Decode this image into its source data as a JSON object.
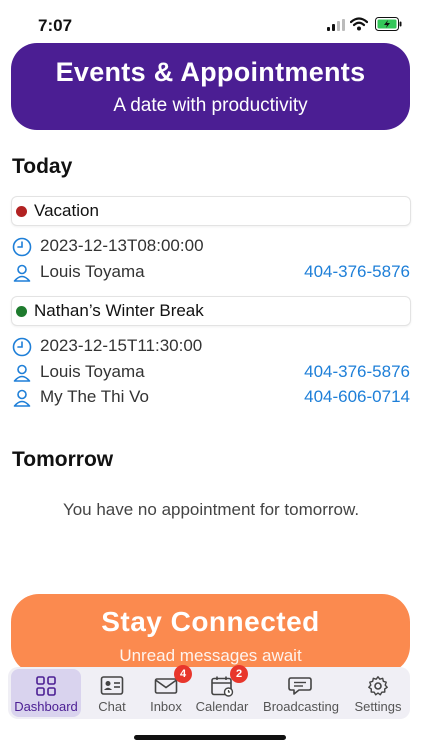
{
  "status": {
    "time": "7:07"
  },
  "header": {
    "title": "Events & Appointments",
    "subtitle": "A date with productivity"
  },
  "today": {
    "heading": "Today",
    "events": [
      {
        "name": "Vacation",
        "color": "#b22222",
        "datetime": "2023-12-13T08:00:00",
        "people": [
          {
            "name": "Louis Toyama",
            "phone": "404-376-5876"
          }
        ]
      },
      {
        "name": "Nathan’s Winter Break",
        "color": "#1e7b2e",
        "datetime": "2023-12-15T11:30:00",
        "people": [
          {
            "name": "Louis Toyama",
            "phone": "404-376-5876"
          },
          {
            "name": "My The Thi Vo",
            "phone": "404-606-0714"
          }
        ]
      }
    ]
  },
  "tomorrow": {
    "heading": "Tomorrow",
    "empty_text": "You have no appointment for tomorrow."
  },
  "promo": {
    "title": "Stay Connected",
    "subtitle": "Unread messages await"
  },
  "tabs": [
    {
      "label": "Dashboard",
      "icon": "grid-icon",
      "badge": ""
    },
    {
      "label": "Chat",
      "icon": "contact-card-icon",
      "badge": ""
    },
    {
      "label": "Inbox",
      "icon": "envelope-icon",
      "badge": "4"
    },
    {
      "label": "Calendar",
      "icon": "calendar-icon",
      "badge": "2"
    },
    {
      "label": "Broadcasting",
      "icon": "speech-bubble-icon",
      "badge": ""
    },
    {
      "label": "Settings",
      "icon": "gear-icon",
      "badge": ""
    }
  ],
  "colors": {
    "header": "#4b1e93",
    "promo": "#fb8a4f",
    "link": "#1e7fd8",
    "accent": "#4b1e93"
  }
}
